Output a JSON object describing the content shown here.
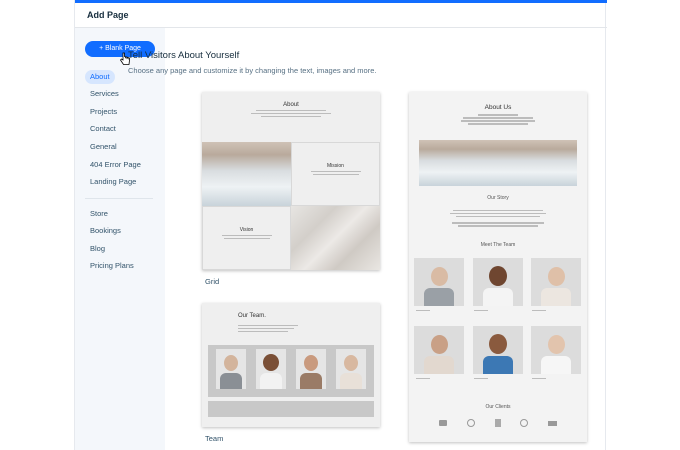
{
  "header": {
    "title": "Add Page"
  },
  "sidebar": {
    "blank_button": "+ Blank Page",
    "items": [
      {
        "label": "About"
      },
      {
        "label": "Services"
      },
      {
        "label": "Projects"
      },
      {
        "label": "Contact"
      },
      {
        "label": "General"
      },
      {
        "label": "404 Error Page"
      },
      {
        "label": "Landing Page"
      }
    ],
    "apps": [
      {
        "label": "Store"
      },
      {
        "label": "Bookings"
      },
      {
        "label": "Blog"
      },
      {
        "label": "Pricing Plans"
      }
    ]
  },
  "main": {
    "title": "Tell Visitors About Yourself",
    "subtitle": "Choose any page and customize it by changing the text, images and more."
  },
  "templates": {
    "grid": {
      "label": "Grid",
      "heading": "About",
      "mission": "Mission",
      "vision": "Vision"
    },
    "team": {
      "label": "Team",
      "heading": "Our Team."
    },
    "about_us": {
      "heading": "About Us",
      "story": "Our Story",
      "meet": "Meet The Team",
      "clients": "Our Clients"
    }
  },
  "colors": {
    "accent": "#116dff",
    "active_bg": "#d6e6fe",
    "sidebar_bg": "#f4f7fb"
  },
  "icons": [
    "pointer-hand-icon"
  ]
}
